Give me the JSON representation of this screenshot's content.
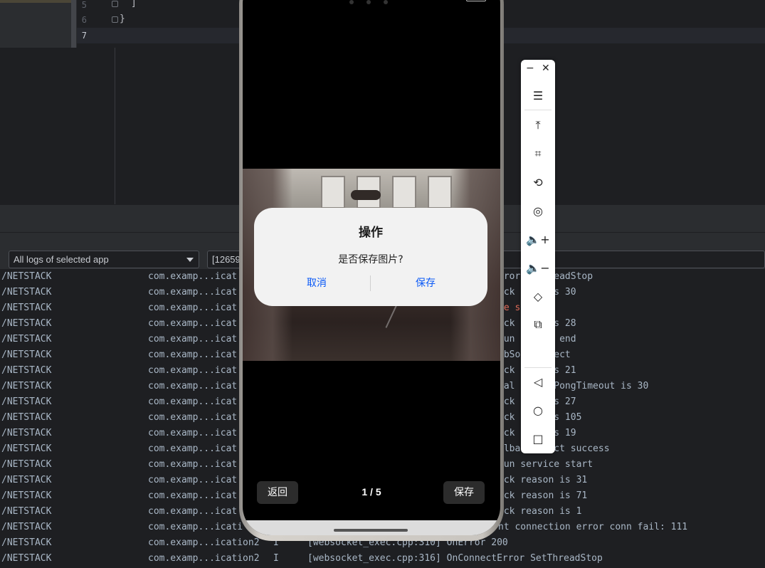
{
  "editor": {
    "lines": [
      {
        "num": "5",
        "code": "]"
      },
      {
        "num": "6",
        "code": "}"
      },
      {
        "num": "7",
        "code": ""
      }
    ]
  },
  "log_toolbar": {
    "app_filter": "All logs of selected app",
    "search_value": "[12659"
  },
  "logs": [
    {
      "tag": "/NETSTACK",
      "pkg": "com.examp...icat",
      "lvl": "",
      "msg": "",
      "err": false
    },
    {
      "tag": "/NETSTACK",
      "pkg": "com.examp...icat",
      "lvl": "",
      "msg": "",
      "err": false
    },
    {
      "tag": "/NETSTACK",
      "pkg": "com.examp...icat",
      "lvl": "",
      "msg": "",
      "err": true
    },
    {
      "tag": "/NETSTACK",
      "pkg": "com.examp...icat",
      "lvl": "",
      "msg": "",
      "err": false
    },
    {
      "tag": "/NETSTACK",
      "pkg": "com.examp...icat",
      "lvl": "",
      "msg": "",
      "err": false
    },
    {
      "tag": "/NETSTACK",
      "pkg": "com.examp...icat",
      "lvl": "",
      "msg": "",
      "err": false
    },
    {
      "tag": "/NETSTACK",
      "pkg": "com.examp...icat",
      "lvl": "",
      "msg": "",
      "err": false
    },
    {
      "tag": "/NETSTACK",
      "pkg": "com.examp...icat",
      "lvl": "",
      "msg": "",
      "err": false
    },
    {
      "tag": "/NETSTACK",
      "pkg": "com.examp...icat",
      "lvl": "",
      "msg": "",
      "err": false
    },
    {
      "tag": "/NETSTACK",
      "pkg": "com.examp...icat",
      "lvl": "",
      "msg": "",
      "err": false
    },
    {
      "tag": "/NETSTACK",
      "pkg": "com.examp...icat",
      "lvl": "",
      "msg": "",
      "err": false
    },
    {
      "tag": "/NETSTACK",
      "pkg": "com.examp...icat",
      "lvl": "",
      "msg": "",
      "err": false
    },
    {
      "tag": "/NETSTACK",
      "pkg": "com.examp...icat",
      "lvl": "",
      "msg": "",
      "err": false
    },
    {
      "tag": "/NETSTACK",
      "pkg": "com.examp...icat",
      "lvl": "",
      "msg": "",
      "err": false
    },
    {
      "tag": "/NETSTACK",
      "pkg": "com.examp...icat",
      "lvl": "",
      "msg": "",
      "err": false
    },
    {
      "tag": "/NETSTACK",
      "pkg": "com.examp...icat",
      "lvl": "",
      "msg": "",
      "err": false
    },
    {
      "tag": "/NETSTACK",
      "pkg": "com.examp...icati",
      "lvl": "",
      "msg": "",
      "err": false
    },
    {
      "tag": "/NETSTACK",
      "pkg": "com.examp...ication2",
      "lvl": "I",
      "msg": "[websocket_exec.cpp:310] OnError 200",
      "err": false
    },
    {
      "tag": "/NETSTACK",
      "pkg": "com.examp...ication2",
      "lvl": "I",
      "msg": "[websocket_exec.cpp:316] OnConnectError SetThreadStop",
      "err": false
    }
  ],
  "log_right_fragments": [
    {
      "row": 0,
      "text": "rror   ThreadStop",
      "err": false
    },
    {
      "row": 1,
      "text": "ack    n is 30",
      "err": false
    },
    {
      "row": 2,
      "text": "ce s",
      "err": true
    },
    {
      "row": 3,
      "text": "ack    n is 28",
      "err": false
    },
    {
      "row": 4,
      "text": "run    ice end",
      "err": false
    },
    {
      "row": 5,
      "text": "ebSo   onnect",
      "err": false
    },
    {
      "row": 6,
      "text": "ack    n is 21",
      "err": false
    },
    {
      "row": 7,
      "text": "val       PongTimeout is 30",
      "err": false
    },
    {
      "row": 8,
      "text": "ack    n is 27",
      "err": false
    },
    {
      "row": 9,
      "text": "ack    n is 105",
      "err": false
    },
    {
      "row": 10,
      "text": "ack    n is 19",
      "err": false
    },
    {
      "row": 11,
      "text": "llba   nnect success",
      "err": false
    },
    {
      "row": 12,
      "text": "run service start",
      "err": false
    },
    {
      "row": 13,
      "text": "ack reason is 31",
      "err": false
    },
    {
      "row": 14,
      "text": "ack reason is 71",
      "err": false
    },
    {
      "row": 15,
      "text": "ack reason is 1",
      "err": false
    },
    {
      "row": 16,
      "text": "nt connection error conn fail: 111",
      "err": false
    }
  ],
  "phone": {
    "dialog": {
      "title": "操作",
      "message": "是否保存图片?",
      "cancel_label": "取消",
      "confirm_label": "保存"
    },
    "back_label": "返回",
    "pager": "1 / 5",
    "save_label": "保存"
  },
  "floatbar": {
    "minimize": "−",
    "close": "✕",
    "buttons": [
      {
        "icon": "menu-icon",
        "glyph": "☰"
      },
      {
        "icon": "pin-top-icon",
        "glyph": "⤒"
      },
      {
        "icon": "crop-icon",
        "glyph": "⌗"
      },
      {
        "icon": "rotate-icon",
        "glyph": "⟲"
      },
      {
        "icon": "screenshot-icon",
        "glyph": "◎"
      },
      {
        "icon": "volume-up-icon",
        "glyph": "🔈+"
      },
      {
        "icon": "volume-down-icon",
        "glyph": "🔈−"
      },
      {
        "icon": "shake-icon",
        "glyph": "◇"
      },
      {
        "icon": "multi-device-icon",
        "glyph": "⧉"
      },
      {
        "icon": "back-icon",
        "glyph": "◁"
      },
      {
        "icon": "home-icon",
        "glyph": "○"
      },
      {
        "icon": "recent-apps-icon",
        "glyph": "□"
      }
    ]
  }
}
